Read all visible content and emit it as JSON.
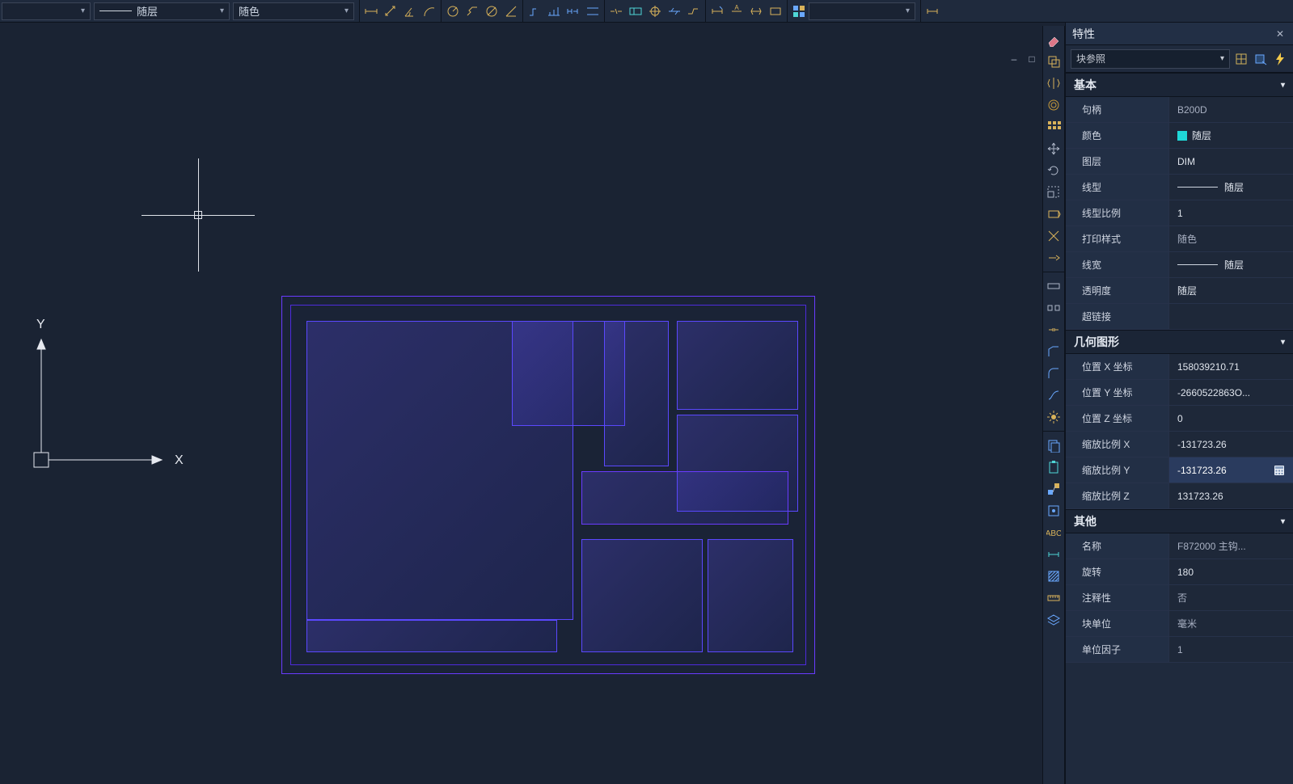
{
  "topbar": {
    "linetype_label": "随层",
    "color_label": "随色"
  },
  "viewport_controls": {
    "minimize": "–",
    "maximize": "□",
    "close": "×"
  },
  "ucs": {
    "x_label": "X",
    "y_label": "Y"
  },
  "properties": {
    "title": "特性",
    "selector_label": "块参照",
    "sections": {
      "basic": {
        "title": "基本",
        "rows": {
          "handle": {
            "label": "句柄",
            "value": "B200D"
          },
          "color": {
            "label": "颜色",
            "value": "随层"
          },
          "layer": {
            "label": "图层",
            "value": "DIM"
          },
          "linetype": {
            "label": "线型",
            "value": "随层"
          },
          "ltscale": {
            "label": "线型比例",
            "value": "1"
          },
          "plotstyle": {
            "label": "打印样式",
            "value": "随色"
          },
          "lineweight": {
            "label": "线宽",
            "value": "随层"
          },
          "transparency": {
            "label": "透明度",
            "value": "随层"
          },
          "hyperlink": {
            "label": "超链接",
            "value": ""
          }
        }
      },
      "geometry": {
        "title": "几何图形",
        "rows": {
          "posx": {
            "label": "位置 X 坐标",
            "value": "158039210.71"
          },
          "posy": {
            "label": "位置 Y 坐标",
            "value": "-2660522863O..."
          },
          "posz": {
            "label": "位置 Z 坐标",
            "value": "0"
          },
          "sx": {
            "label": "缩放比例 X",
            "value": "-131723.26"
          },
          "sy": {
            "label": "缩放比例 Y",
            "value": "-131723.26"
          },
          "sz": {
            "label": "缩放比例 Z",
            "value": "131723.26"
          }
        }
      },
      "other": {
        "title": "其他",
        "rows": {
          "name": {
            "label": "名称",
            "value": "F872000 主钩..."
          },
          "rotation": {
            "label": "旋转",
            "value": "180"
          },
          "annotative": {
            "label": "注释性",
            "value": "否"
          },
          "blockunit": {
            "label": "块单位",
            "value": "毫米"
          },
          "unitfactor": {
            "label": "单位因子",
            "value": "1"
          }
        }
      }
    }
  }
}
